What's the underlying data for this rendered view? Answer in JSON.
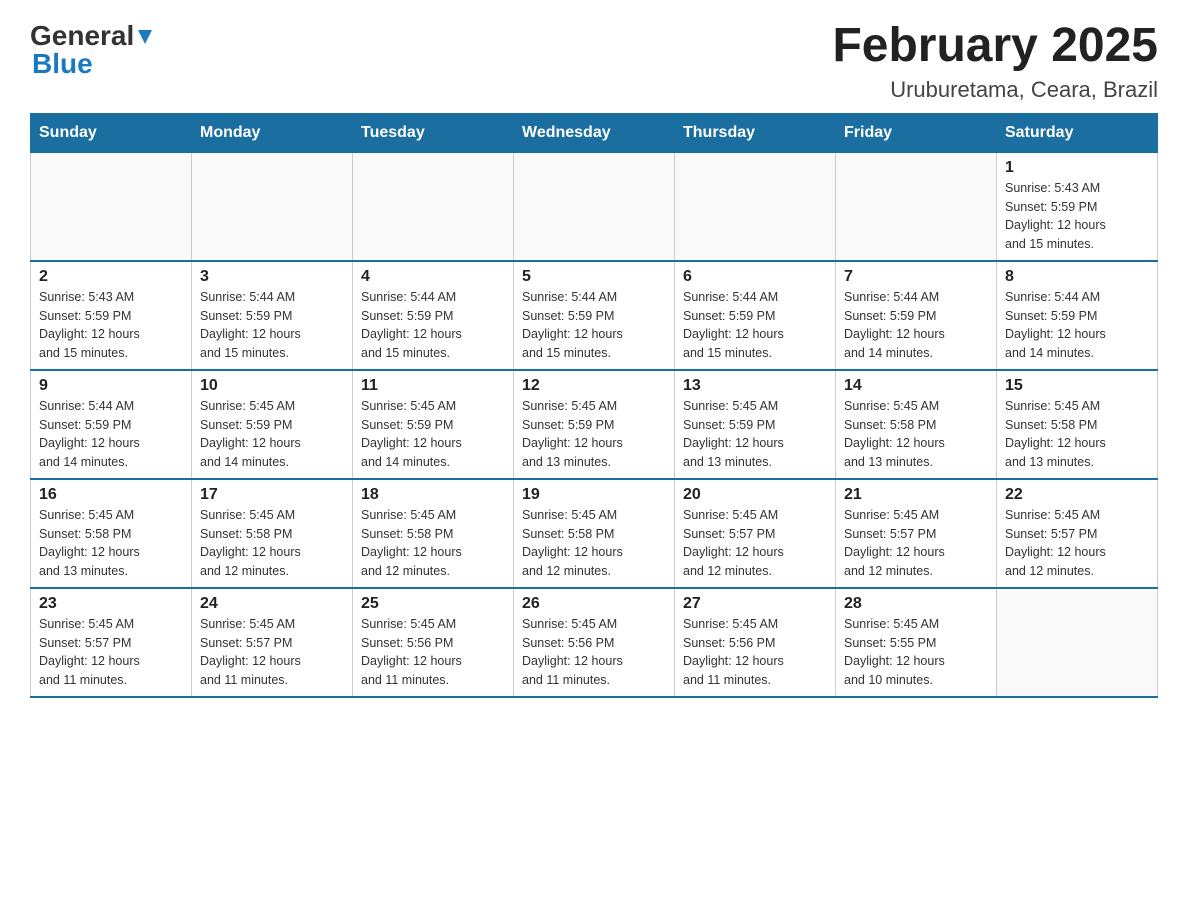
{
  "header": {
    "logo": {
      "general": "General",
      "blue": "Blue"
    },
    "title": "February 2025",
    "location": "Uruburetama, Ceara, Brazil"
  },
  "calendar": {
    "days_of_week": [
      "Sunday",
      "Monday",
      "Tuesday",
      "Wednesday",
      "Thursday",
      "Friday",
      "Saturday"
    ],
    "weeks": [
      [
        {
          "day": "",
          "info": ""
        },
        {
          "day": "",
          "info": ""
        },
        {
          "day": "",
          "info": ""
        },
        {
          "day": "",
          "info": ""
        },
        {
          "day": "",
          "info": ""
        },
        {
          "day": "",
          "info": ""
        },
        {
          "day": "1",
          "info": "Sunrise: 5:43 AM\nSunset: 5:59 PM\nDaylight: 12 hours\nand 15 minutes."
        }
      ],
      [
        {
          "day": "2",
          "info": "Sunrise: 5:43 AM\nSunset: 5:59 PM\nDaylight: 12 hours\nand 15 minutes."
        },
        {
          "day": "3",
          "info": "Sunrise: 5:44 AM\nSunset: 5:59 PM\nDaylight: 12 hours\nand 15 minutes."
        },
        {
          "day": "4",
          "info": "Sunrise: 5:44 AM\nSunset: 5:59 PM\nDaylight: 12 hours\nand 15 minutes."
        },
        {
          "day": "5",
          "info": "Sunrise: 5:44 AM\nSunset: 5:59 PM\nDaylight: 12 hours\nand 15 minutes."
        },
        {
          "day": "6",
          "info": "Sunrise: 5:44 AM\nSunset: 5:59 PM\nDaylight: 12 hours\nand 15 minutes."
        },
        {
          "day": "7",
          "info": "Sunrise: 5:44 AM\nSunset: 5:59 PM\nDaylight: 12 hours\nand 14 minutes."
        },
        {
          "day": "8",
          "info": "Sunrise: 5:44 AM\nSunset: 5:59 PM\nDaylight: 12 hours\nand 14 minutes."
        }
      ],
      [
        {
          "day": "9",
          "info": "Sunrise: 5:44 AM\nSunset: 5:59 PM\nDaylight: 12 hours\nand 14 minutes."
        },
        {
          "day": "10",
          "info": "Sunrise: 5:45 AM\nSunset: 5:59 PM\nDaylight: 12 hours\nand 14 minutes."
        },
        {
          "day": "11",
          "info": "Sunrise: 5:45 AM\nSunset: 5:59 PM\nDaylight: 12 hours\nand 14 minutes."
        },
        {
          "day": "12",
          "info": "Sunrise: 5:45 AM\nSunset: 5:59 PM\nDaylight: 12 hours\nand 13 minutes."
        },
        {
          "day": "13",
          "info": "Sunrise: 5:45 AM\nSunset: 5:59 PM\nDaylight: 12 hours\nand 13 minutes."
        },
        {
          "day": "14",
          "info": "Sunrise: 5:45 AM\nSunset: 5:58 PM\nDaylight: 12 hours\nand 13 minutes."
        },
        {
          "day": "15",
          "info": "Sunrise: 5:45 AM\nSunset: 5:58 PM\nDaylight: 12 hours\nand 13 minutes."
        }
      ],
      [
        {
          "day": "16",
          "info": "Sunrise: 5:45 AM\nSunset: 5:58 PM\nDaylight: 12 hours\nand 13 minutes."
        },
        {
          "day": "17",
          "info": "Sunrise: 5:45 AM\nSunset: 5:58 PM\nDaylight: 12 hours\nand 12 minutes."
        },
        {
          "day": "18",
          "info": "Sunrise: 5:45 AM\nSunset: 5:58 PM\nDaylight: 12 hours\nand 12 minutes."
        },
        {
          "day": "19",
          "info": "Sunrise: 5:45 AM\nSunset: 5:58 PM\nDaylight: 12 hours\nand 12 minutes."
        },
        {
          "day": "20",
          "info": "Sunrise: 5:45 AM\nSunset: 5:57 PM\nDaylight: 12 hours\nand 12 minutes."
        },
        {
          "day": "21",
          "info": "Sunrise: 5:45 AM\nSunset: 5:57 PM\nDaylight: 12 hours\nand 12 minutes."
        },
        {
          "day": "22",
          "info": "Sunrise: 5:45 AM\nSunset: 5:57 PM\nDaylight: 12 hours\nand 12 minutes."
        }
      ],
      [
        {
          "day": "23",
          "info": "Sunrise: 5:45 AM\nSunset: 5:57 PM\nDaylight: 12 hours\nand 11 minutes."
        },
        {
          "day": "24",
          "info": "Sunrise: 5:45 AM\nSunset: 5:57 PM\nDaylight: 12 hours\nand 11 minutes."
        },
        {
          "day": "25",
          "info": "Sunrise: 5:45 AM\nSunset: 5:56 PM\nDaylight: 12 hours\nand 11 minutes."
        },
        {
          "day": "26",
          "info": "Sunrise: 5:45 AM\nSunset: 5:56 PM\nDaylight: 12 hours\nand 11 minutes."
        },
        {
          "day": "27",
          "info": "Sunrise: 5:45 AM\nSunset: 5:56 PM\nDaylight: 12 hours\nand 11 minutes."
        },
        {
          "day": "28",
          "info": "Sunrise: 5:45 AM\nSunset: 5:55 PM\nDaylight: 12 hours\nand 10 minutes."
        },
        {
          "day": "",
          "info": ""
        }
      ]
    ]
  }
}
